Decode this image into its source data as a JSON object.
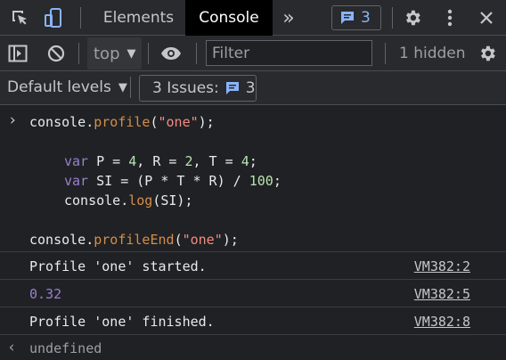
{
  "tabs": {
    "elements": "Elements",
    "console": "Console",
    "more": "»"
  },
  "issues_count_top": "3",
  "toolbar": {
    "context": "top",
    "filter_placeholder": "Filter",
    "hidden": "1 hidden"
  },
  "levels": {
    "label": "Default levels",
    "issues_label": "3 Issues:",
    "issues_count": "3"
  },
  "code": {
    "prompt": "›",
    "l1": [
      "console.",
      "profile",
      "(",
      "\"one\"",
      ");"
    ],
    "l2": [
      "var",
      " P = ",
      "4",
      ", R = ",
      "2",
      ", T = ",
      "4",
      ";"
    ],
    "l3": [
      "var",
      " SI = (P * T * R) / ",
      "100",
      ";"
    ],
    "l4": [
      "console.",
      "log",
      "(SI);"
    ],
    "l5": [
      "console.",
      "profileEnd",
      "(",
      "\"one\"",
      ");"
    ]
  },
  "messages": [
    {
      "text": "Profile 'one' started.",
      "source": "VM382:2"
    },
    {
      "text": "0.32",
      "source": "VM382:5"
    },
    {
      "text": "Profile 'one' finished.",
      "source": "VM382:8"
    }
  ],
  "result": {
    "prompt": "‹",
    "text": "undefined"
  },
  "colors": {
    "accent": "#8ab4f8",
    "number": "#9a7fd1"
  }
}
